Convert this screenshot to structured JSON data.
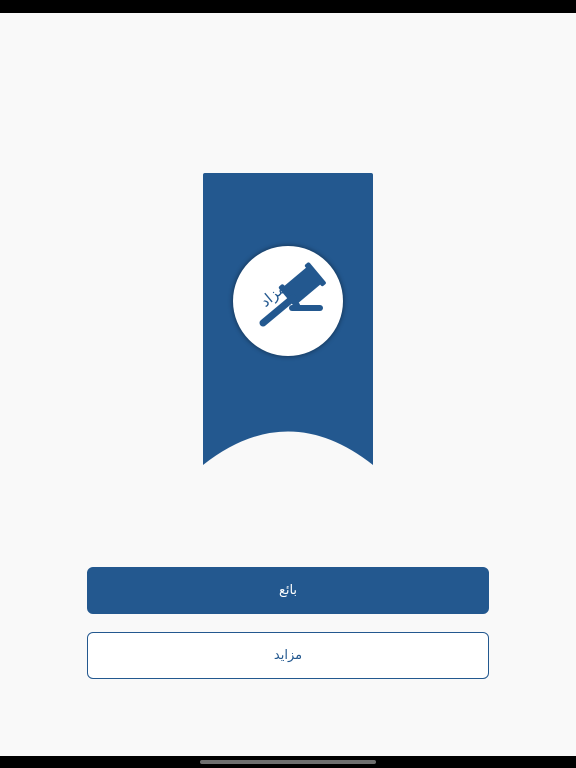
{
  "colors": {
    "brand": "#23588f",
    "background": "#f9f9f9",
    "button_text_light": "#ffffff"
  },
  "logo": {
    "icon": "gavel-icon",
    "wordmark": "مزاد"
  },
  "buttons": {
    "seller_label": "بائع",
    "bidder_label": "مزايد"
  }
}
